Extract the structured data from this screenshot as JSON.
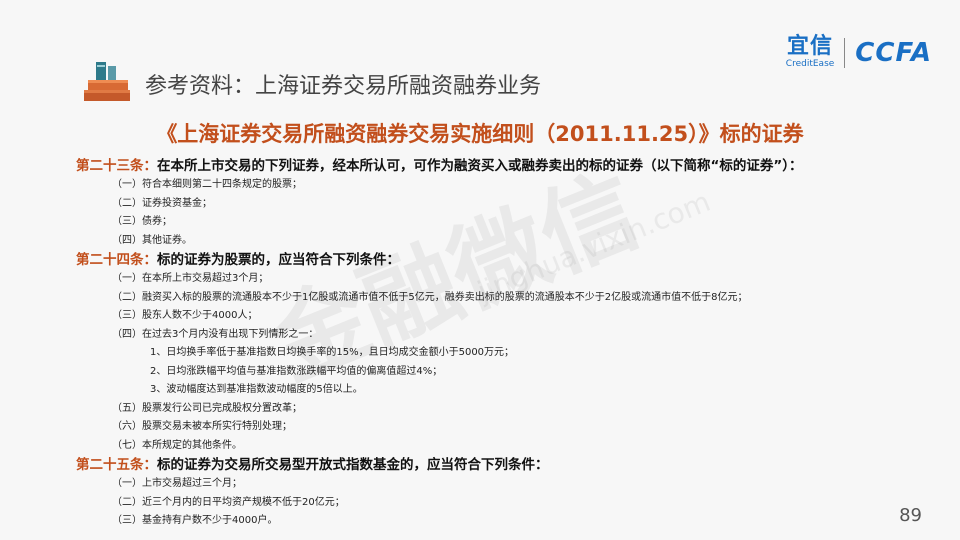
{
  "logos": {
    "yixin_cn": "宜信",
    "yixin_en": "CreditEase",
    "ccfa": "CCFA"
  },
  "header": {
    "title": "参考资料：上海证券交易所融资融券业务"
  },
  "doc_title": "《上海证券交易所融资融券交易实施细则（2011.11.25）》标的证券",
  "art23": {
    "num": "第二十三条：",
    "text": "在本所上市交易的下列证券，经本所认可，可作为融资买入或融券卖出的标的证券（以下简称“标的证券”）："
  },
  "art23_items": [
    "（一）符合本细则第二十四条规定的股票；",
    "（二）证券投资基金；",
    "（三）债券；",
    "（四）其他证券。"
  ],
  "art24": {
    "num": "第二十四条：",
    "text": "标的证券为股票的，应当符合下列条件："
  },
  "art24_items": [
    "（一）在本所上市交易超过3个月；",
    "（二）融资买入标的股票的流通股本不少于1亿股或流通市值不低于5亿元，融券卖出标的股票的流通股本不少于2亿股或流通市值不低于8亿元；",
    "（三）股东人数不少于4000人；",
    "（四）在过去3个月内没有出现下列情形之一："
  ],
  "art24_sub": [
    "1、日均换手率低于基准指数日均换手率的15%，且日均成交金额小于5000万元；",
    "2、日均涨跌幅平均值与基准指数涨跌幅平均值的偏离值超过4%；",
    "3、波动幅度达到基准指数波动幅度的5倍以上。"
  ],
  "art24_items2": [
    "（五）股票发行公司已完成股权分置改革；",
    "（六）股票交易未被本所实行特别处理；",
    "（七）本所规定的其他条件。"
  ],
  "art25": {
    "num": "第二十五条：",
    "text": "标的证券为交易所交易型开放式指数基金的，应当符合下列条件："
  },
  "art25_items": [
    "（一）上市交易超过三个月；",
    "（二）近三个月内的日平均资产规模不低于20亿元；",
    "（三）基金持有户数不少于4000户。"
  ],
  "watermark": {
    "main": "金融微信",
    "sub": "jinghua.vixin.com"
  },
  "page_number": "89"
}
